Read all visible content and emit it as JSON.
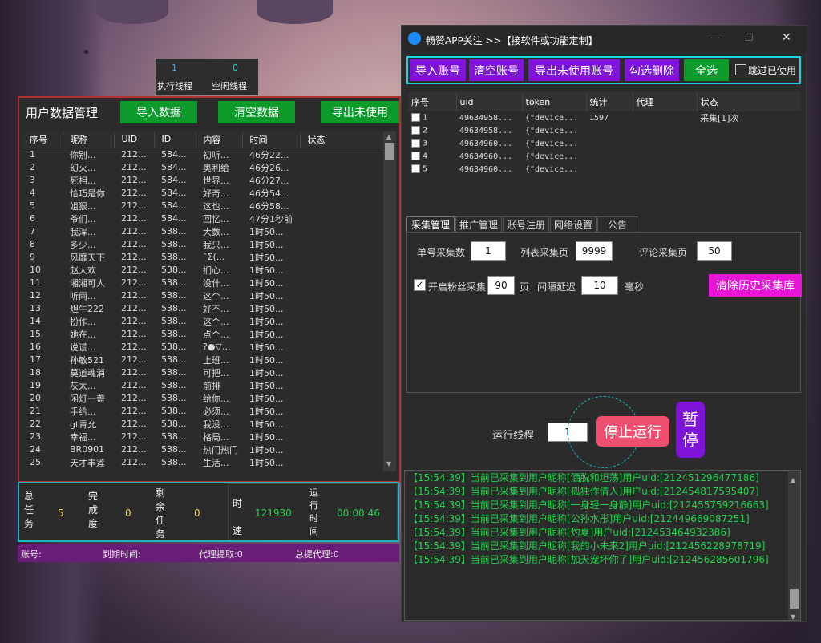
{
  "threads": {
    "exec_value": "1",
    "exec_label": "执行线程",
    "idle_value": "0",
    "idle_label": "空闲线程"
  },
  "left": {
    "title": "用户数据管理",
    "buttons": {
      "import": "导入数据",
      "clear": "清空数据",
      "export": "导出未使用"
    },
    "columns": [
      "序号",
      "昵称",
      "UID",
      "ID",
      "内容",
      "时间",
      "状态"
    ],
    "rows": [
      [
        "1",
        "你别...",
        "212...",
        "584...",
        "初听...",
        "46分22..."
      ],
      [
        "2",
        "幻灭...",
        "212...",
        "584...",
        "奥利给",
        "46分26..."
      ],
      [
        "3",
        "死相...",
        "212...",
        "584...",
        "世界...",
        "46分27..."
      ],
      [
        "4",
        "恰巧是你",
        "212...",
        "584...",
        "好奇...",
        "46分54..."
      ],
      [
        "5",
        "姐狠...",
        "212...",
        "584...",
        "这也...",
        "46分58..."
      ],
      [
        "6",
        "爷们...",
        "212...",
        "584...",
        "回忆...",
        "47分1秒前"
      ],
      [
        "7",
        "我浑...",
        "212...",
        "538...",
        "大数...",
        "1时50..."
      ],
      [
        "8",
        "多少...",
        "212...",
        "538...",
        "我只...",
        "1时50..."
      ],
      [
        "9",
        "风靡天下",
        "212...",
        "538...",
        "ˆΣ(...",
        "1时50..."
      ],
      [
        "10",
        "赵大欢",
        "212...",
        "538...",
        "扪心...",
        "1时50..."
      ],
      [
        "11",
        "湘湘可人",
        "212...",
        "538...",
        "没什...",
        "1时50..."
      ],
      [
        "12",
        "听雨...",
        "212...",
        "538...",
        "这个...",
        "1时50..."
      ],
      [
        "13",
        "炟牛222",
        "212...",
        "538...",
        "好不...",
        "1时50..."
      ],
      [
        "14",
        "扮作...",
        "212...",
        "538...",
        "这个...",
        "1时50..."
      ],
      [
        "15",
        "她在...",
        "212...",
        "538...",
        "点个...",
        "1时50..."
      ],
      [
        "16",
        "说谎...",
        "212...",
        "538...",
        "?●▽...",
        "1时50..."
      ],
      [
        "17",
        "孙敏521",
        "212...",
        "538...",
        "上班...",
        "1时50..."
      ],
      [
        "18",
        "莫道魂消",
        "212...",
        "538...",
        "可把...",
        "1时50..."
      ],
      [
        "19",
        "灰太...",
        "212...",
        "538...",
        "前排",
        "1时50..."
      ],
      [
        "20",
        "闲灯一盏",
        "212...",
        "538...",
        "给你...",
        "1时50..."
      ],
      [
        "21",
        "手给...",
        "212...",
        "538...",
        "必须...",
        "1时50..."
      ],
      [
        "22",
        "gt青允",
        "212...",
        "538...",
        "我没...",
        "1时50..."
      ],
      [
        "23",
        "幸福...",
        "212...",
        "538...",
        "格局...",
        "1时50..."
      ],
      [
        "24",
        "BR0901",
        "212...",
        "538...",
        "热门热门",
        "1时50..."
      ],
      [
        "25",
        "天才丰莲",
        "212...",
        "538...",
        "生活...",
        "1时50..."
      ]
    ]
  },
  "stats": {
    "total_label": "总任务",
    "total": "5",
    "done_label": "完成度",
    "done": "0",
    "remain_label": "剩余任务",
    "remain": "0",
    "speed_label": "时速",
    "speed": "121930",
    "runtime_label": "运行时间",
    "runtime": "00:00:46"
  },
  "status_bar": {
    "account": "账号:",
    "expire": "到期时间:",
    "agent": "代理提取:0",
    "total_agent": "总提代理:0"
  },
  "window": {
    "title": "畅赞APP关注 >>【接软件或功能定制】",
    "minimize": "—",
    "maximize": "☐",
    "close": "✕"
  },
  "toolbar": {
    "import": "导入账号",
    "clear": "清空账号",
    "export": "导出未使用账号",
    "del": "勾选删除",
    "all": "全选",
    "skip": "跳过已使用"
  },
  "accounts": {
    "columns": [
      "序号",
      "uid",
      "token",
      "统计",
      "代理",
      "状态"
    ],
    "rows": [
      [
        "1",
        "49634958...",
        "{\"device...",
        "1597",
        "",
        "采集[1]次"
      ],
      [
        "2",
        "49634958...",
        "{\"device...",
        "",
        "",
        ""
      ],
      [
        "3",
        "49634960...",
        "{\"device...",
        "",
        "",
        ""
      ],
      [
        "4",
        "49634960...",
        "{\"device...",
        "",
        "",
        ""
      ],
      [
        "5",
        "49634960...",
        "{\"device...",
        "",
        "",
        ""
      ]
    ]
  },
  "tabs": [
    "采集管理",
    "推广管理",
    "账号注册",
    "网络设置",
    "公告"
  ],
  "collect": {
    "single_label": "单号采集数",
    "single": "1",
    "pages_label": "列表采集页",
    "pages": "9999",
    "comment_label": "评论采集页",
    "comment": "50",
    "fans_label": "开启粉丝采集",
    "fans": "90",
    "fans_unit": "页",
    "delay_label": "间隔延迟",
    "delay": "10",
    "delay_unit": "毫秒",
    "clear_btn": "清除历史采集库"
  },
  "run": {
    "threads_label": "运行线程",
    "threads": "1",
    "stop": "停止运行",
    "pause": "暂停"
  },
  "log": [
    "【15:54:39】当前已采集到用户昵称[洒脱和坦荡]用户uid:[212451296477186]",
    "【15:54:39】当前已采集到用户昵称[孤独作倩人]用户uid:[212454817595407]",
    "【15:54:39】当前已采集到用户昵称[一身轻一身静]用户uid:[212455759216663]",
    "【15:54:39】当前已采集到用户昵称[公孙水彤]用户uid:[212449669087251]",
    "【15:54:39】当前已采集到用户昵称[灼夏]用户uid:[212453464932386]",
    "【15:54:39】当前已采集到用户昵称[我的小未来2]用户uid:[212456228978719]",
    "【15:54:39】当前已采集到用户昵称[加天宠坏你了]用户uid:[212456285601796]"
  ]
}
